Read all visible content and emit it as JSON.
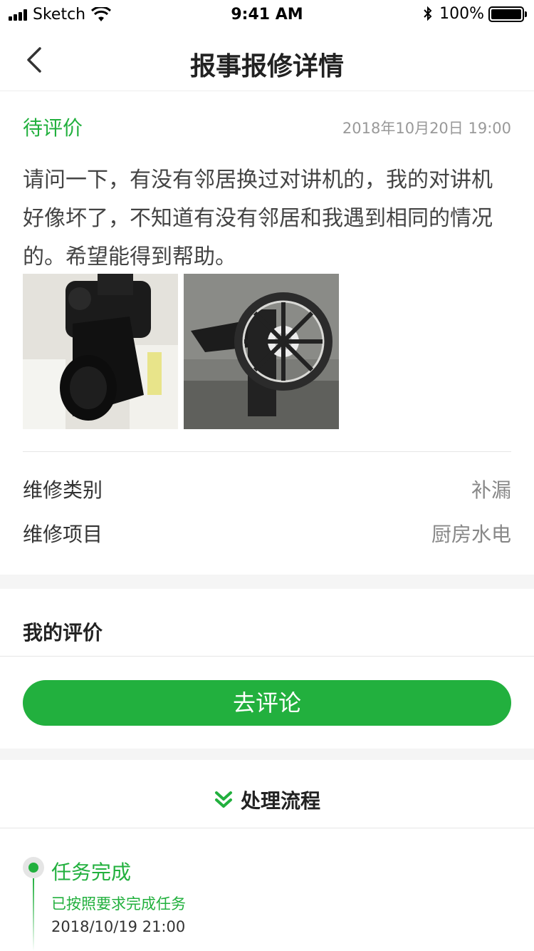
{
  "status_bar": {
    "carrier": "Sketch",
    "time": "9:41 AM",
    "battery": "100%"
  },
  "nav": {
    "title": "报事报修详情",
    "back_icon": "chevron-left-icon"
  },
  "report": {
    "status": "待评价",
    "date": "2018年10月20日 19:00",
    "description": "请问一下，有没有邻居换过对讲机的，我的对讲机好像坏了，不知道有没有邻居和我遇到相同的情况的。希望能得到帮助。",
    "photos": [
      "camera-photo",
      "sewing-machine-photo"
    ],
    "details": [
      {
        "label": "维修类别",
        "value": "补漏"
      },
      {
        "label": "维修项目",
        "value": "厨房水电"
      }
    ]
  },
  "review": {
    "title": "我的评价",
    "button_label": "去评论"
  },
  "flow": {
    "title": "处理流程",
    "icon": "double-chevron-down-icon",
    "steps": [
      {
        "title": "任务完成",
        "subtitle": "已按照要求完成任务",
        "time": "2018/10/19 21:00"
      }
    ]
  },
  "colors": {
    "accent": "#22b03e",
    "text": "#333333",
    "muted": "#999999"
  }
}
